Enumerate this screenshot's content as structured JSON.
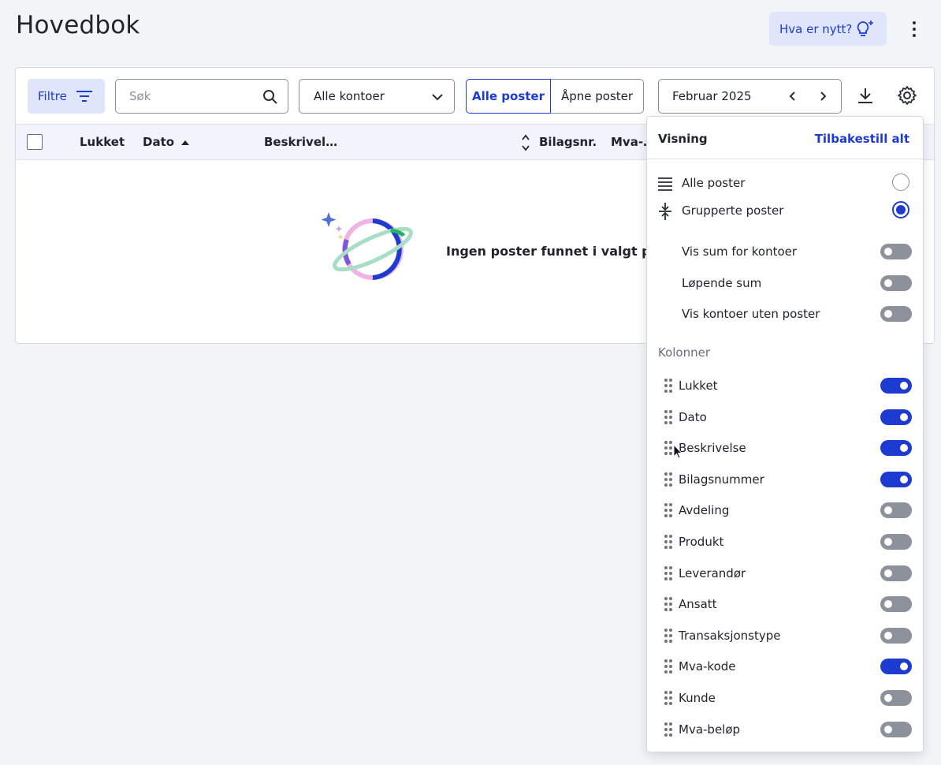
{
  "page": {
    "title": "Hovedbok"
  },
  "header": {
    "whats_new": "Hva er nytt?"
  },
  "toolbar": {
    "filter_label": "Filtre",
    "search_placeholder": "Søk",
    "account_select": "Alle kontoer",
    "segment_all": "Alle poster",
    "segment_open": "Åpne poster",
    "period": "Februar 2025"
  },
  "table": {
    "headers": {
      "closed": "Lukket",
      "date": "Dato",
      "description": "Beskrivel…",
      "voucher": "Bilagsnr.",
      "vat": "Mva-…"
    },
    "empty_text": "Ingen poster funnet i valgt per"
  },
  "panel": {
    "title": "Visning",
    "reset": "Tilbakestill alt",
    "view_options": [
      {
        "label": "Alle poster",
        "icon": "list-lines-icon",
        "selected": false
      },
      {
        "label": "Grupperte poster",
        "icon": "collapse-rows-icon",
        "selected": true
      }
    ],
    "toggles": [
      {
        "label": "Vis sum for kontoer",
        "on": false
      },
      {
        "label": "Løpende sum",
        "on": false
      },
      {
        "label": "Vis kontoer uten poster",
        "on": false
      }
    ],
    "columns_label": "Kolonner",
    "columns": [
      {
        "label": "Lukket",
        "on": true
      },
      {
        "label": "Dato",
        "on": true
      },
      {
        "label": "Beskrivelse",
        "on": true
      },
      {
        "label": "Bilagsnummer",
        "on": true
      },
      {
        "label": "Avdeling",
        "on": false
      },
      {
        "label": "Produkt",
        "on": false
      },
      {
        "label": "Leverandør",
        "on": false
      },
      {
        "label": "Ansatt",
        "on": false
      },
      {
        "label": "Transaksjonstype",
        "on": false
      },
      {
        "label": "Mva-kode",
        "on": true
      },
      {
        "label": "Kunde",
        "on": false
      },
      {
        "label": "Mva-beløp",
        "on": false
      }
    ]
  },
  "colors": {
    "accent": "#1d3bd1",
    "accent_bg": "#dfe6fb",
    "toggle_off": "#8d919c"
  }
}
